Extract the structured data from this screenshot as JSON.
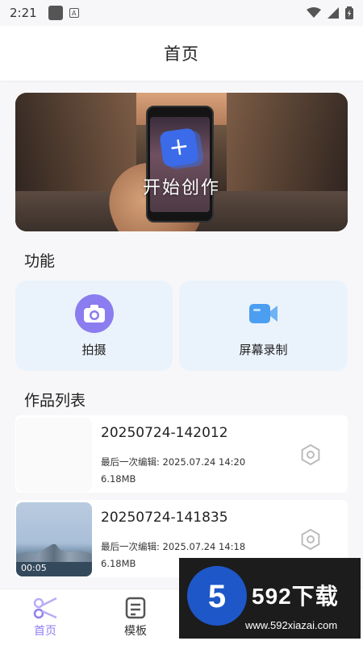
{
  "status_bar": {
    "time": "2:21",
    "sim_icon": "square-icon",
    "notif_icon": "a-icon",
    "wifi_icon": "wifi-icon",
    "signal_icon": "signal-icon",
    "battery_icon": "battery-icon"
  },
  "header": {
    "title": "首页"
  },
  "hero": {
    "label": "开始创作",
    "icon": "plus-icon"
  },
  "functions": {
    "title": "功能",
    "items": [
      {
        "label": "拍摄",
        "icon": "camera-icon",
        "color": "#8b7cf0"
      },
      {
        "label": "屏幕录制",
        "icon": "video-camera-icon",
        "color": "#4b9ef0"
      }
    ]
  },
  "works": {
    "title": "作品列表",
    "items": [
      {
        "name": "20250724-142012",
        "edited": "最后一次编辑: 2025.07.24 14:20",
        "size": "6.18MB",
        "duration": ""
      },
      {
        "name": "20250724-141835",
        "edited": "最后一次编辑: 2025.07.24 14:18",
        "size": "6.18MB",
        "duration": "00:05"
      }
    ]
  },
  "bottom_nav": {
    "items": [
      {
        "label": "首页",
        "icon": "scissors-icon",
        "active": true
      },
      {
        "label": "模板",
        "icon": "template-icon",
        "active": false
      }
    ]
  },
  "watermark": {
    "number": "5",
    "brand": "592下载",
    "url": "www.592xiazai.com"
  },
  "colors": {
    "accent": "#8b7cf0",
    "active_nav": "#8f7ff0",
    "card_bg": "#eaf3fb"
  }
}
